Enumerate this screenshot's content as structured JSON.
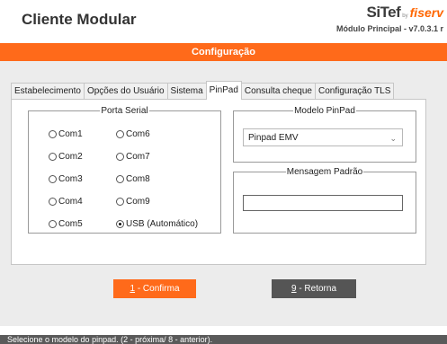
{
  "header": {
    "title": "Cliente Modular",
    "brand": {
      "sitef": "SiTef",
      "by": "by",
      "fiserv": "fiserv"
    },
    "module": "Módulo Principal - v7.0.3.1 r"
  },
  "section_title": "Configuração",
  "tabs": [
    {
      "label": "Estabelecimento"
    },
    {
      "label": "Opções do Usuário"
    },
    {
      "label": "Sistema"
    },
    {
      "label": "PinPad"
    },
    {
      "label": "Consulta cheque"
    },
    {
      "label": "Configuração TLS"
    }
  ],
  "porta_serial": {
    "legend": "Porta Serial",
    "options": [
      {
        "label": "Com1",
        "checked": false
      },
      {
        "label": "Com2",
        "checked": false
      },
      {
        "label": "Com3",
        "checked": false
      },
      {
        "label": "Com4",
        "checked": false
      },
      {
        "label": "Com5",
        "checked": false
      },
      {
        "label": "Com6",
        "checked": false
      },
      {
        "label": "Com7",
        "checked": false
      },
      {
        "label": "Com8",
        "checked": false
      },
      {
        "label": "Com9",
        "checked": false
      },
      {
        "label": "USB (Automático)",
        "checked": true
      }
    ]
  },
  "modelo_pinpad": {
    "legend": "Modelo PinPad",
    "selected": "Pinpad EMV",
    "icon": "chevron-down-icon"
  },
  "mensagem_padrao": {
    "legend": "Mensagem Padrão",
    "value": ""
  },
  "buttons": {
    "confirm_key": "1",
    "confirm_label": " - Confirma",
    "return_key": "9",
    "return_label": " - Retorna"
  },
  "status": "Selecione o modelo do pinpad. (2 - próxima/ 8 - anterior).",
  "colors": {
    "accent": "#ff6a1a",
    "return_button": "#555555",
    "status_bar": "#5a5a5a"
  }
}
